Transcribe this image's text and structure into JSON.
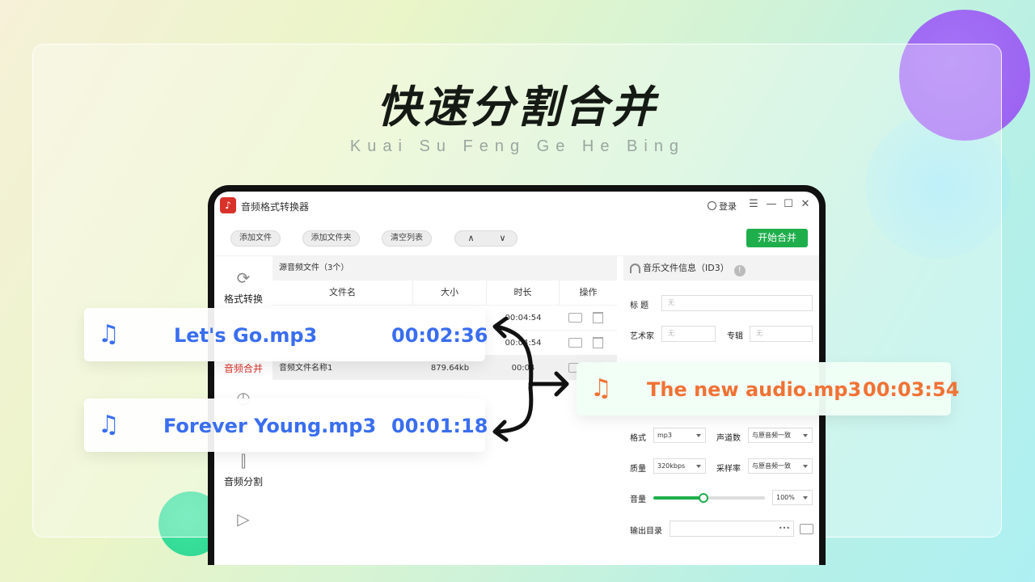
{
  "hero": {
    "title": "快速分割合并",
    "subtitle": "Kuai Su Feng Ge He Bing"
  },
  "app": {
    "logo_glyph": "♪",
    "name": "音频格式转换器",
    "login_label": "登录",
    "window_controls": [
      "☰",
      "—",
      "☐",
      "✕"
    ]
  },
  "toolbar": {
    "add_file": "添加文件",
    "add_folder": "添加文件夹",
    "clear_list": "清空列表",
    "move_up": "∧",
    "move_down": "∨",
    "start_button": "开始合并"
  },
  "sidebar": {
    "items": [
      {
        "label": "格式转换",
        "icon": "refresh-icon",
        "glyph": "⟳"
      },
      {
        "label": "音频合并",
        "icon": "merge-icon",
        "glyph": "",
        "active": true
      },
      {
        "label": "",
        "icon": "clock-icon",
        "glyph": "◷"
      },
      {
        "label": "音频分割",
        "icon": "split-icon",
        "glyph": "⫿"
      },
      {
        "label": "",
        "icon": "video-icon",
        "glyph": "▷"
      }
    ]
  },
  "file_panel": {
    "header": "源音频文件（3个）",
    "columns": [
      "文件名",
      "大小",
      "时长",
      "操作"
    ],
    "rows": [
      {
        "name": "",
        "size": "",
        "duration": "00:04:54"
      },
      {
        "name": "",
        "size": "",
        "duration": "00:04:54"
      },
      {
        "name": "音频文件名称1",
        "size": "879.64kb",
        "duration": "00:04"
      }
    ]
  },
  "id3_panel": {
    "header": "音乐文件信息（ID3）",
    "info_icon": "!",
    "title_label": "标  题",
    "title_placeholder": "无",
    "artist_label": "艺术家",
    "artist_placeholder": "无",
    "album_label": "专辑",
    "album_placeholder": "无",
    "format_label": "格式",
    "format_value": "mp3",
    "channels_label": "声道数",
    "channels_value": "与原音频一致",
    "quality_label": "质量",
    "quality_value": "320kbps",
    "samplerate_label": "采样率",
    "samplerate_value": "与原音频一致",
    "volume_label": "音量",
    "volume_value": "100%",
    "volume_level": 0.45,
    "output_label": "输出目录",
    "output_more": "•••"
  },
  "cards": {
    "note_glyph": "♫",
    "input1": {
      "name": "Let's Go.mp3",
      "time": "00:02:36"
    },
    "input2": {
      "name": "Forever Young.mp3",
      "time": "00:01:18"
    },
    "output": {
      "name": "The new audio.mp3",
      "time": "00:03:54"
    }
  },
  "colors": {
    "accent_green": "#1fae4c",
    "active_red": "#d9322a",
    "card_blue": "#3a6ef0",
    "card_orange": "#f07235"
  }
}
